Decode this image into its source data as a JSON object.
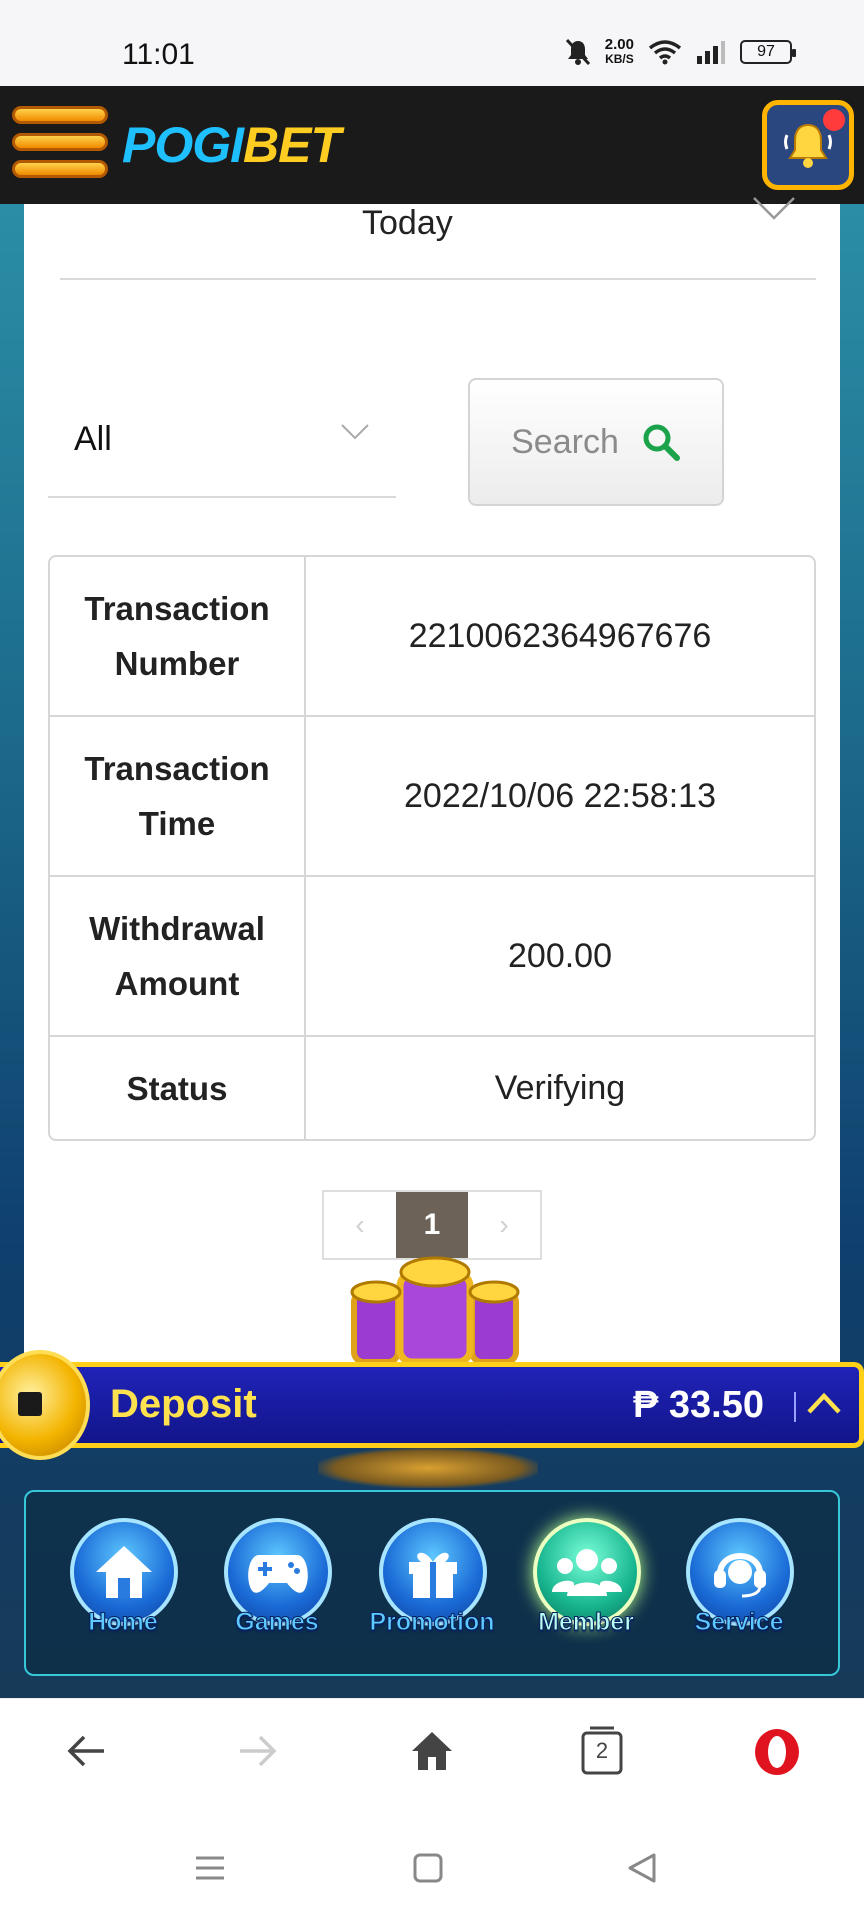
{
  "status_bar": {
    "time": "11:01",
    "net_speed_value": "2.00",
    "net_speed_unit": "KB/S",
    "battery": "97"
  },
  "header": {
    "logo_part1": "POGI",
    "logo_part2": "BET"
  },
  "filters": {
    "date_range": "Today",
    "type_select": "All",
    "search_label": "Search"
  },
  "transaction": {
    "rows": [
      {
        "label": "Transaction Number",
        "value": "2210062364967676"
      },
      {
        "label": "Transaction Time",
        "value": "2022/10/06 22:58:13"
      },
      {
        "label": "Withdrawal Amount",
        "value": "200.00"
      },
      {
        "label": "Status",
        "value": "Verifying"
      }
    ]
  },
  "pagination": {
    "current_page": "1"
  },
  "deposit_bar": {
    "label": "Deposit",
    "balance": "₱ 33.50"
  },
  "bottom_nav": {
    "items": [
      {
        "label": "Home",
        "icon": "home-icon"
      },
      {
        "label": "Games",
        "icon": "gamepad-icon"
      },
      {
        "label": "Promotion",
        "icon": "gift-icon"
      },
      {
        "label": "Member",
        "icon": "members-icon",
        "active": true
      },
      {
        "label": "Service",
        "icon": "headset-icon"
      }
    ]
  },
  "browser": {
    "tab_count": "2"
  },
  "colors": {
    "accent_gold": "#ffcf1a",
    "deposit_blue": "#1f23b8",
    "search_green": "#1aa34a",
    "pager_active": "#6d6257"
  }
}
